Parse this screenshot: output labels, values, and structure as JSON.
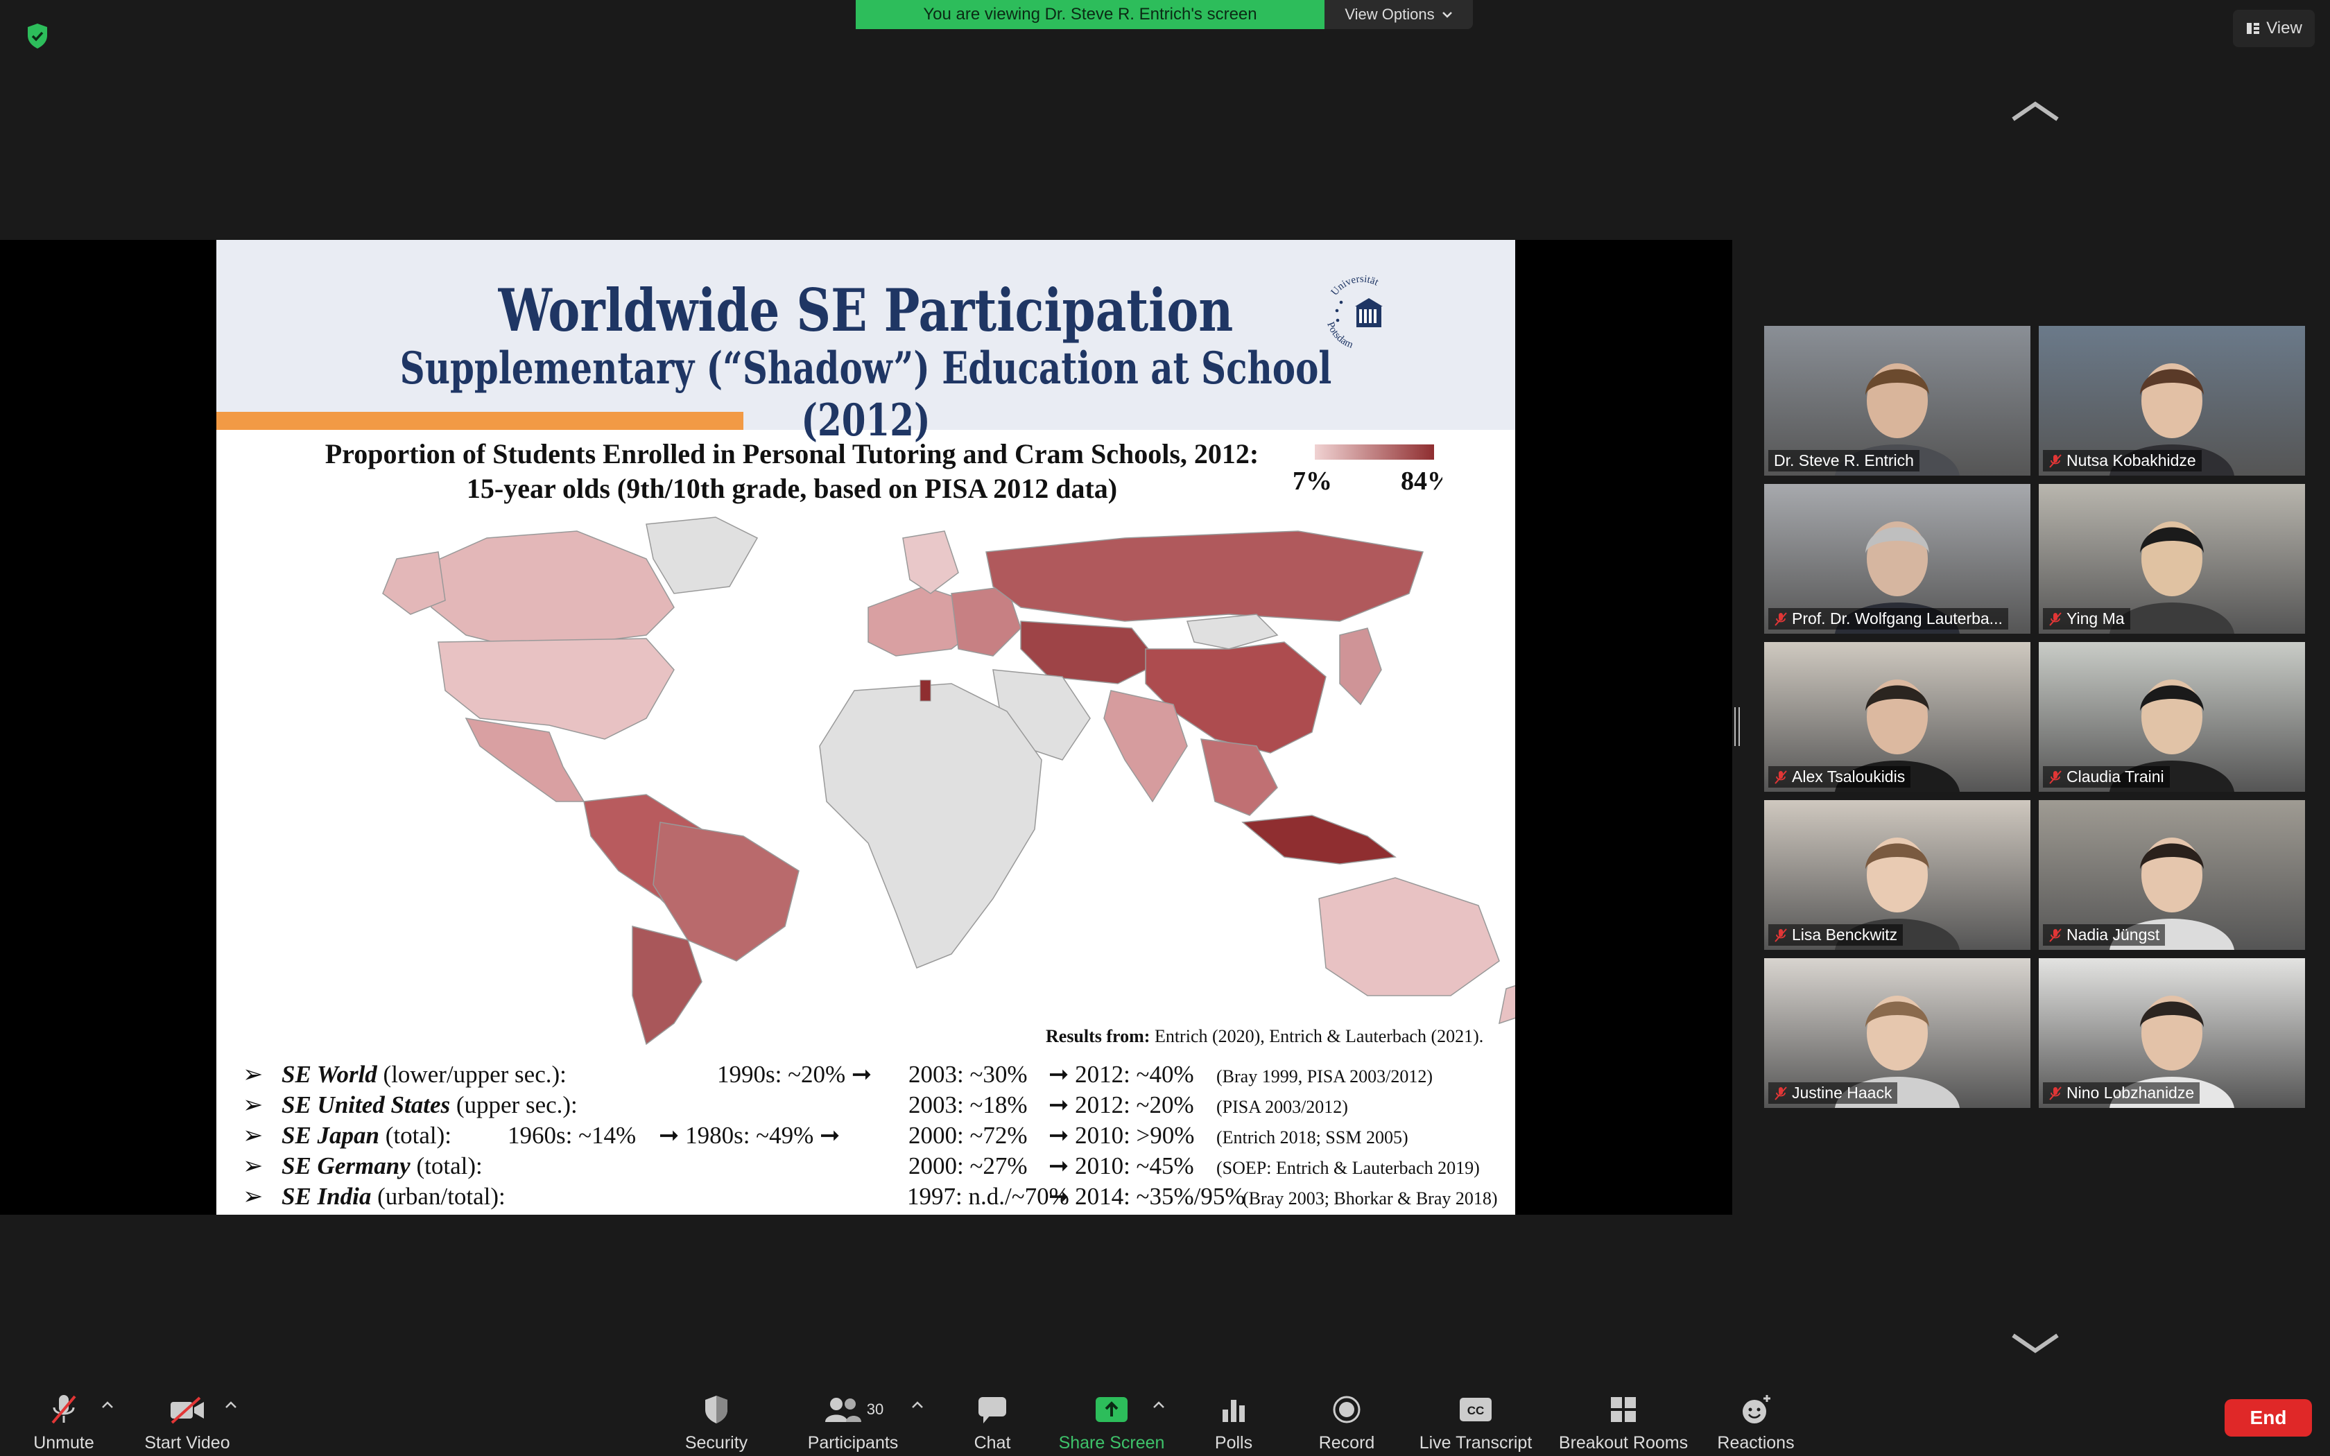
{
  "banner": {
    "viewing_text": "You are viewing Dr. Steve R. Entrich's screen",
    "view_options_label": "View Options"
  },
  "view_button_label": "View",
  "slide": {
    "title": "Worldwide SE Participation",
    "subtitle": "Supplementary (“Shadow”) Education at School (2012)",
    "logo_text_top": "Universität",
    "logo_text_bottom": "Potsdam",
    "map_title_line1": "Proportion of Students Enrolled in Personal Tutoring and Cram Schools, 2012:",
    "map_title_line2": "15-year olds (9th/10th grade, based on PISA 2012 data)",
    "legend_min": "7%",
    "legend_max": "84%",
    "results_from_label": "Results from:",
    "results_from_refs": "Entrich (2020), Entrich & Lauterbach (2021).",
    "rows": [
      {
        "label_bold": "SE World",
        "label_rest": " (lower/upper sec.):",
        "c1": "",
        "c2": "1990s: ~20% ➞",
        "c3": "2003: ~30%",
        "c4": "➞ 2012: ~40%",
        "ref": "(Bray 1999, PISA 2003/2012)"
      },
      {
        "label_bold": "SE United States",
        "label_rest": " (upper sec.):",
        "c1": "",
        "c2": "",
        "c3": "2003: ~18%",
        "c4": "➞ 2012: ~20%",
        "ref": "(PISA 2003/2012)"
      },
      {
        "label_bold": "SE Japan",
        "label_rest": " (total):",
        "c1": "1960s: ~14%",
        "c2": "➞ 1980s: ~49% ➞",
        "c3": "2000: ~72%",
        "c4": "➞ 2010: >90%",
        "ref": "(Entrich 2018; SSM 2005)"
      },
      {
        "label_bold": "SE Germany",
        "label_rest": " (total):",
        "c1": "",
        "c2": "",
        "c3": "2000: ~27%",
        "c4": "➞ 2010: ~45%",
        "ref": "(SOEP: Entrich & Lauterbach 2019)"
      },
      {
        "label_bold": "SE India",
        "label_rest": " (urban/total):",
        "c1": "",
        "c2": "1997: n.d./~70%",
        "c3": "",
        "c4": "➞ 2014: ~35%/95%",
        "ref": "(Bray 2003; Bhorkar & Bray 2018)"
      }
    ]
  },
  "participants": [
    {
      "name": "Dr. Steve R. Entrich",
      "muted": false,
      "active": true,
      "bg": "#8a8f96",
      "skin": "#d9b59b",
      "hair": "#6b4a2e",
      "shirt": "#4b4d52"
    },
    {
      "name": "Nutsa Kobakhidze",
      "muted": true,
      "active": false,
      "bg": "#6b7a8a",
      "skin": "#e2c0a5",
      "hair": "#5a3a28",
      "shirt": "#2f2f33"
    },
    {
      "name": "Prof. Dr. Wolfgang Lauterba...",
      "muted": true,
      "active": false,
      "bg": "#a7a9ad",
      "skin": "#d6b6a0",
      "hair": "#bfbfbf",
      "shirt": "#2a2d36"
    },
    {
      "name": "Ying Ma",
      "muted": true,
      "active": false,
      "bg": "#b9b6ae",
      "skin": "#e0c2a2",
      "hair": "#1b1b1b",
      "shirt": "#3c3c3c"
    },
    {
      "name": "Alex Tsaloukidis",
      "muted": true,
      "active": false,
      "bg": "#cfc9c0",
      "skin": "#dcb9a0",
      "hair": "#2b2520",
      "shirt": "#1c1c1c"
    },
    {
      "name": "Claudia Traini",
      "muted": true,
      "active": false,
      "bg": "#c9ccc7",
      "skin": "#e1c3a7",
      "hair": "#1a1a1a",
      "shirt": "#202020"
    },
    {
      "name": "Lisa Benckwitz",
      "muted": true,
      "active": false,
      "bg": "#cfc8bf",
      "skin": "#e9cbb3",
      "hair": "#7a5a40",
      "shirt": "#3b3b3b"
    },
    {
      "name": "Nadia Jüngst",
      "muted": true,
      "active": false,
      "bg": "#9f9b93",
      "skin": "#e5c6ad",
      "hair": "#2a211c",
      "shirt": "#dcdcdc"
    },
    {
      "name": "Justine Haack",
      "muted": true,
      "active": false,
      "bg": "#d8d4cf",
      "skin": "#e6c7ae",
      "hair": "#8a6a4d",
      "shirt": "#cfcfcf"
    },
    {
      "name": "Nino Lobzhanidze",
      "muted": true,
      "active": false,
      "bg": "#e3e3e1",
      "skin": "#e3c2a8",
      "hair": "#2b2420",
      "shirt": "#e6e6e6"
    }
  ],
  "toolbar": {
    "unmute": "Unmute",
    "start_video": "Start Video",
    "security": "Security",
    "participants": "Participants",
    "participants_count": "30",
    "chat": "Chat",
    "share_screen": "Share Screen",
    "polls": "Polls",
    "record": "Record",
    "live_transcript": "Live Transcript",
    "breakout_rooms": "Breakout Rooms",
    "reactions": "Reactions",
    "end": "End"
  },
  "colors": {
    "share_green": "#2dbd5b",
    "end_red": "#e02828",
    "active_speaker": "#c8e06a",
    "map_dark": "#8f2e30",
    "map_light": "#f0d2d2"
  }
}
